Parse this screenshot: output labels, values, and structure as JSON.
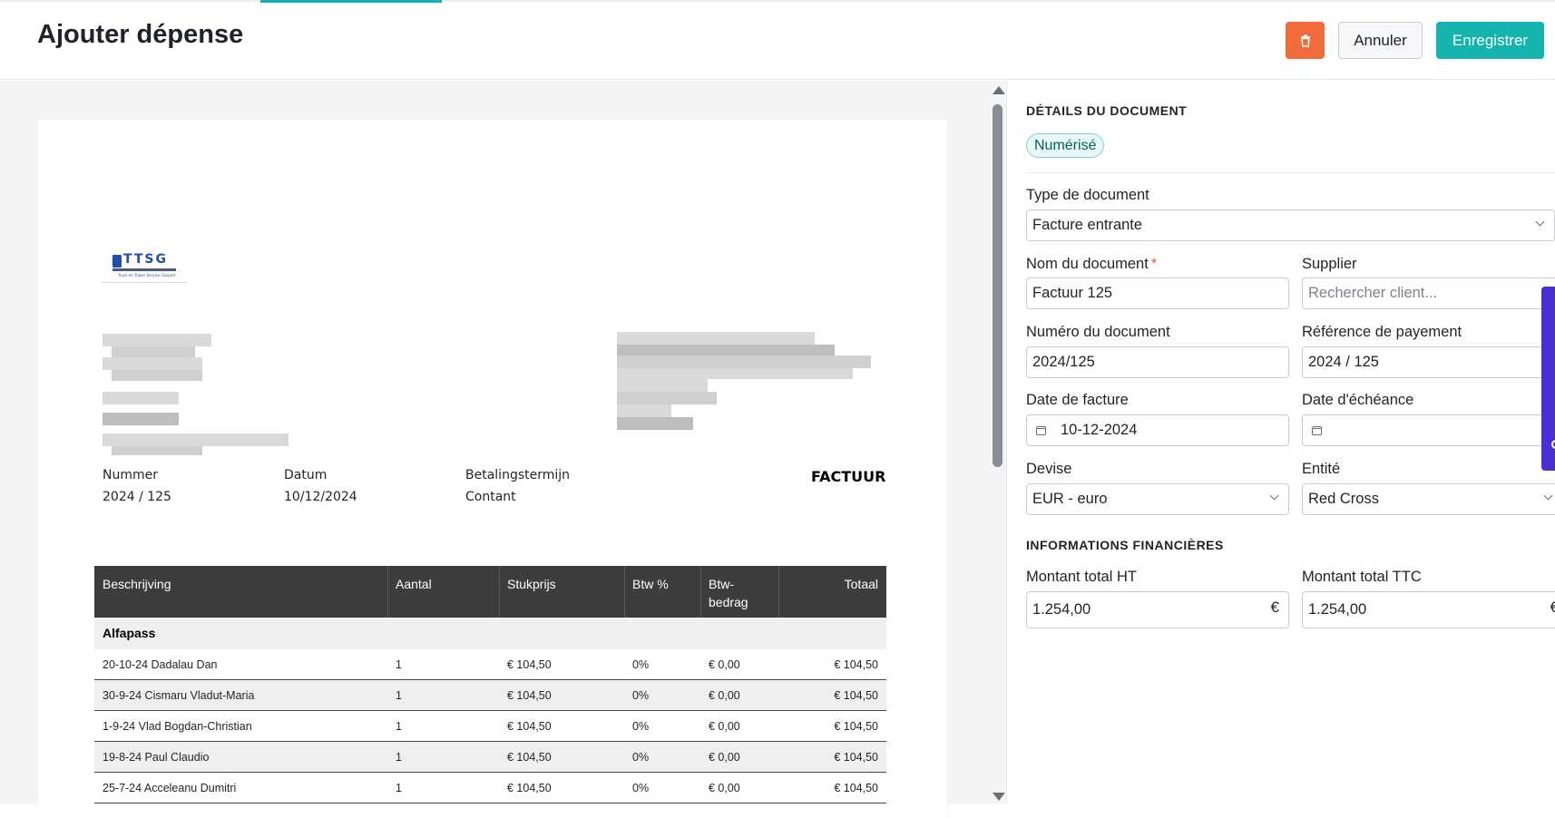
{
  "header": {
    "title": "Ajouter dépense",
    "cancel_label": "Annuler",
    "save_label": "Enregistrer",
    "delete_icon": "trash-icon"
  },
  "colors": {
    "accent": "#14b3ad",
    "danger": "#f26b3a",
    "widget": "#4b2fd6"
  },
  "invoice": {
    "meta": [
      {
        "label": "Nummer",
        "value": "2024 / 125"
      },
      {
        "label": "Datum",
        "value": "10/12/2024"
      },
      {
        "label": "Betalingstermijn",
        "value": "Contant"
      }
    ],
    "doc_type": "FACTUUR",
    "columns": [
      "Beschrijving",
      "Aantal",
      "Stukprijs",
      "Btw %",
      "Btw-\nbedrag",
      "Totaal"
    ],
    "section": "Alfapass",
    "rows": [
      {
        "desc": "20-10-24 Dadalau Dan",
        "qty": "1",
        "price": "€ 104,50",
        "vat": "0%",
        "vat_amount": "€ 0,00",
        "total": "€ 104,50"
      },
      {
        "desc": "30-9-24 Cismaru Vladut-Maria",
        "qty": "1",
        "price": "€ 104,50",
        "vat": "0%",
        "vat_amount": "€ 0,00",
        "total": "€ 104,50"
      },
      {
        "desc": "1-9-24 Vlad Bogdan-Christian",
        "qty": "1",
        "price": "€ 104,50",
        "vat": "0%",
        "vat_amount": "€ 0,00",
        "total": "€ 104,50"
      },
      {
        "desc": "19-8-24 Paul Claudio",
        "qty": "1",
        "price": "€ 104,50",
        "vat": "0%",
        "vat_amount": "€ 0,00",
        "total": "€ 104,50"
      },
      {
        "desc": "25-7-24 Acceleanu Dumitri",
        "qty": "1",
        "price": "€ 104,50",
        "vat": "0%",
        "vat_amount": "€ 0,00",
        "total": "€ 104,50"
      }
    ]
  },
  "panel": {
    "details_title": "DÉTAILS DU DOCUMENT",
    "status_badge": "Numérisé",
    "doc_type_label": "Type de document",
    "doc_type_value": "Facture entrante",
    "doc_name_label": "Nom du document",
    "doc_name_value": "Factuur 125",
    "supplier_label": "Supplier",
    "supplier_placeholder": "Rechercher client...",
    "doc_number_label": "Numéro du document",
    "doc_number_value": "2024/125",
    "payment_ref_label": "Référence de payement",
    "payment_ref_value": "2024 / 125",
    "invoice_date_label": "Date de facture",
    "invoice_date_value": "10-12-2024",
    "due_date_label": "Date d'échéance",
    "due_date_value": "",
    "currency_label": "Devise",
    "currency_value": "EUR - euro",
    "entity_label": "Entité",
    "entity_value": "Red Cross",
    "finance_title": "INFORMATIONS FINANCIÈRES",
    "total_ht_label": "Montant total HT",
    "total_ht_value": "1.254,00",
    "total_ttc_label": "Montant total TTC",
    "total_ttc_value": "1.254,00",
    "currency_symbol": "€"
  }
}
